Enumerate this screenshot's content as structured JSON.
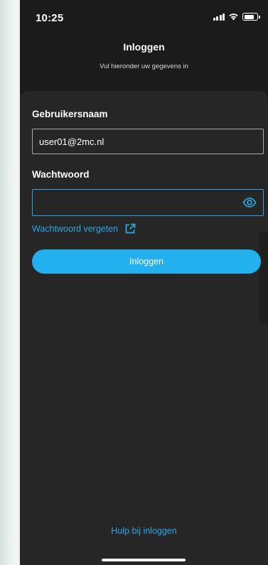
{
  "status_bar": {
    "time": "10:25",
    "icons": [
      "signal-icon",
      "wifi-icon",
      "battery-icon"
    ]
  },
  "header": {
    "title": "Inloggen",
    "subtitle": "Vul hieronder uw gegevens in"
  },
  "form": {
    "username_label": "Gebruikersnaam",
    "username_value": "user01@2mc.nl",
    "password_label": "Wachtwoord",
    "password_value": "",
    "password_toggle_icon": "eye-icon",
    "forgot_password_label": "Wachtwoord vergeten",
    "forgot_password_icon": "external-link-icon",
    "login_button_label": "Inloggen"
  },
  "footer": {
    "help_label": "Hulp bij inloggen"
  },
  "colors": {
    "background": "#1b1b1b",
    "sheet": "#262626",
    "accent": "#22b0ee",
    "link": "#2aa8e6",
    "text": "#ffffff"
  }
}
